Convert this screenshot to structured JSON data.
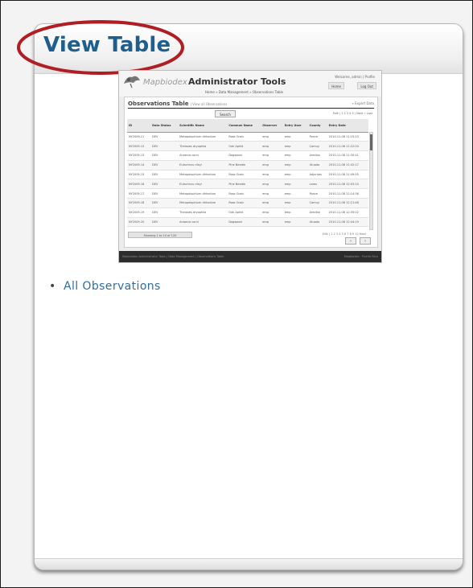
{
  "page": {
    "title": "View Table"
  },
  "thumbnail": {
    "brand": "Mapbiodex",
    "app_title": "Administrator Tools",
    "breadcrumb": "Home  »  Data Management  »  Observations Table",
    "user": "Welcome, admin | Profile",
    "nav_home": "Home",
    "nav_logout": "Log Out",
    "heading": "Observations Table",
    "heading_sub": "| View all Observations",
    "export_label": "» Export Data",
    "search_button": "Search",
    "paging": "Edit   | 1 2 3 4 5  |  Next  »  Last",
    "columns": [
      "ID",
      "Data Status",
      "Scientific Name",
      "Common Name",
      "Observer",
      "Entry User",
      "County",
      "Entry Date"
    ],
    "rows": [
      [
        "NY2009-11",
        "DEV",
        "Metopolophium dirhodum",
        "Rose Grain",
        "emp",
        "emp",
        "Ponce",
        "2010-11-08 11:15:23"
      ],
      [
        "NY2009-12",
        "DEV",
        "Thelaxes dryophila",
        "Oak Aphid",
        "emp",
        "emp",
        "Camuy",
        "2010-11-08 11:22:04"
      ],
      [
        "NY2009-13",
        "DEV",
        "Anoecia corni",
        "Dogwood",
        "emp",
        "emp",
        "Arecibo",
        "2010-11-08 11:30:41"
      ],
      [
        "NY2009-14",
        "DEV",
        "Eulachnus rileyi",
        "Pine Needle",
        "emp",
        "emp",
        "Utuado",
        "2010-11-08 11:42:17"
      ],
      [
        "NY2009-15",
        "DEV",
        "Metopolophium dirhodum",
        "Rose Grain",
        "emp",
        "emp",
        "Adjuntas",
        "2010-11-08 11:49:55"
      ],
      [
        "NY2009-16",
        "DEV",
        "Eulachnus rileyi",
        "Pine Needle",
        "emp",
        "emp",
        "Lares",
        "2010-11-08 12:03:10"
      ],
      [
        "NY2009-17",
        "DEV",
        "Metopolophium dirhodum",
        "Rose Grain",
        "emp",
        "emp",
        "Ponce",
        "2010-11-08 12:14:36"
      ],
      [
        "NY2009-18",
        "DEV",
        "Metopolophium dirhodum",
        "Rose Grain",
        "emp",
        "emp",
        "Camuy",
        "2010-11-08 12:21:48"
      ],
      [
        "NY2009-19",
        "DEV",
        "Thelaxes dryophila",
        "Oak Aphid",
        "emp",
        "emp",
        "Arecibo",
        "2010-11-08 12:35:02"
      ],
      [
        "NY2009-20",
        "DEV",
        "Anoecia corni",
        "Dogwood",
        "emp",
        "emp",
        "Utuado",
        "2010-11-08 12:44:19"
      ]
    ],
    "bottom_tab": "Showing 1 to 10 of 120",
    "count": "Edit   | 1 2 3 4 5 6 7 8 9 10  Next",
    "prev": "‹",
    "next": "›",
    "footer_left": "Mapbiodex Administrator Tools  |  Data Management  |  Observations Table",
    "footer_right": "Mapbiodex · Puerto Rico"
  },
  "links": [
    {
      "label": "All Observations"
    }
  ],
  "colors": {
    "title": "#1e5f8e",
    "link": "#2d6ea6",
    "highlight": "#b01e24"
  }
}
